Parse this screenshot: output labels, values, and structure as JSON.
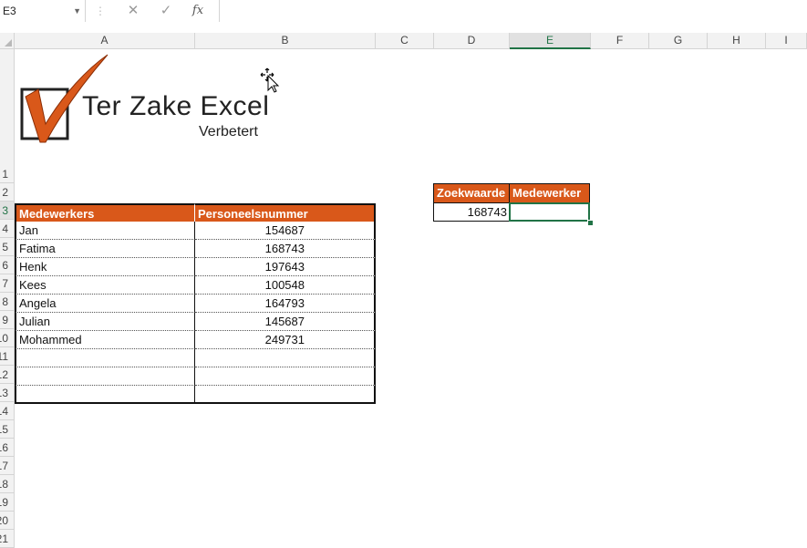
{
  "formula_bar": {
    "name_box": "E3",
    "cancel_glyph": "✕",
    "enter_glyph": "✓",
    "fx_glyph": "fx",
    "formula": ""
  },
  "columns": [
    "A",
    "B",
    "C",
    "D",
    "E",
    "F",
    "G",
    "H",
    "I"
  ],
  "selected_column": "E",
  "rows": [
    "1",
    "2",
    "3",
    "4",
    "5",
    "6",
    "7",
    "8",
    "9",
    "10",
    "11",
    "12",
    "13",
    "14",
    "15",
    "16",
    "17",
    "18",
    "19",
    "20",
    "21"
  ],
  "selected_row": "3",
  "logo": {
    "text": "Ter Zake Excel",
    "subtitle": "Verbetert"
  },
  "employee_table": {
    "header_name": "Medewerkers",
    "header_number": "Personeelsnummer",
    "rows": [
      {
        "name": "Jan",
        "number": "154687"
      },
      {
        "name": "Fatima",
        "number": "168743"
      },
      {
        "name": "Henk",
        "number": "197643"
      },
      {
        "name": "Kees",
        "number": "100548"
      },
      {
        "name": "Angela",
        "number": "164793"
      },
      {
        "name": "Julian",
        "number": "145687"
      },
      {
        "name": "Mohammed",
        "number": "249731"
      },
      {
        "name": "",
        "number": ""
      },
      {
        "name": "",
        "number": ""
      },
      {
        "name": "",
        "number": ""
      }
    ]
  },
  "lookup": {
    "header_key": "Zoekwaarde",
    "header_result": "Medewerker",
    "key_value": "168743",
    "result_value": ""
  },
  "colors": {
    "header_orange": "#d9581a",
    "selection_green": "#217346"
  }
}
